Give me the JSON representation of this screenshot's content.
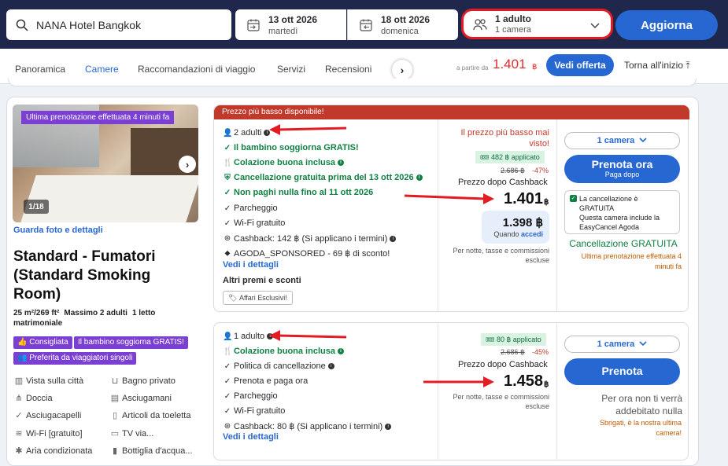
{
  "search": {
    "destination": "NANA Hotel Bangkok"
  },
  "checkin": {
    "date": "13 ott 2026",
    "day": "martedì"
  },
  "checkout": {
    "date": "18 ott 2026",
    "day": "domenica"
  },
  "guests": {
    "adults": "1 adulto",
    "rooms": "1 camera"
  },
  "update_label": "Aggiorna",
  "nav": {
    "tabs": [
      "Panoramica",
      "Camere",
      "Raccomandazioni di viaggio",
      "Servizi",
      "Recensioni"
    ],
    "active_tab": "Camere",
    "from_label": "a partire da",
    "from_price": "1.401",
    "from_currency": "฿",
    "offer_button": "Vedi offerta",
    "back_to_top": "Torna all'inizio"
  },
  "room": {
    "image_badge": "Ultima prenotazione effettuata 4 minuti fa",
    "image_count": "1/18",
    "photo_link": "Guarda foto e dettagli",
    "title": "Standard - Fumatori (Standard Smoking Room)",
    "size": "25 m²/269 ft²",
    "max_guests": "Massimo 2 adulti",
    "bed": "1 letto matrimoniale",
    "pills": [
      "Consigliata",
      "Il bambino soggiorna GRATIS!",
      "Preferita da viaggiatori singoli"
    ],
    "amenities": [
      "Vista sulla città",
      "Bagno privato",
      "Doccia",
      "Asciugamani",
      "Asciugacapelli",
      "Articoli da toeletta",
      "Wi-Fi [gratuito]",
      "TV via...",
      "Aria condizionata",
      "Bottiglia d'acqua..."
    ]
  },
  "offer1": {
    "header": "Prezzo più basso disponibile!",
    "occupancy": "2 adulti",
    "child_free": "Il bambino soggiorna GRATIS!",
    "breakfast": "Colazione buona inclusa",
    "free_cancel": "Cancellazione gratuita prima del 13 ott 2026",
    "pay_later": "Non paghi nulla fino al 11 ott 2026",
    "parking": "Parcheggio",
    "wifi": "Wi-Fi gratuito",
    "cashback": "Cashback: 142 ฿ (Si applicano i termini)",
    "sponsored": "AGODA_SPONSORED - 69 ฿ di sconto!",
    "details_link": "Vedi i dettagli",
    "other_title": "Altri premi e sconti",
    "exclusive_tag": "Affari Esclusivi!",
    "lowest_note": "Il prezzo più basso mai visto!",
    "applied": "482 ฿ applicato",
    "original_price": "2.686 ฿",
    "discount": "-47%",
    "after_cashback_label": "Prezzo dopo Cashback",
    "price": "1.401",
    "currency": "฿",
    "access_price": "1.398 ฿",
    "access_label": "Quando",
    "access_link": "accedi",
    "per_night": "Per notte, tasse e commissioni escluse",
    "room_select": "1 camera",
    "book_label": "Prenota ora",
    "book_sub": "Paga dopo",
    "cancel_title": "La cancellazione è GRATUITA",
    "cancel_body": "Questa camera include la EasyCancel Agoda",
    "free_cancel_green": "Cancellazione GRATUITA",
    "last_booked": "Ultima prenotazione effettuata 4 minuti fa"
  },
  "offer2": {
    "occupancy": "1 adulto",
    "breakfast": "Colazione buona inclusa",
    "cancel_policy": "Politica di cancellazione",
    "pay_later": "Prenota e paga ora",
    "parking": "Parcheggio",
    "wifi": "Wi-Fi gratuito",
    "cashback": "Cashback: 80 ฿ (Si applicano i termini)",
    "details_link": "Vedi i dettagli",
    "applied": "80 ฿ applicato",
    "original_price": "2.686 ฿",
    "discount": "-45%",
    "after_cashback_label": "Prezzo dopo Cashback",
    "price": "1.458",
    "currency": "฿",
    "per_night": "Per notte, tasse e commissioni escluse",
    "room_select": "1 camera",
    "book_label": "Prenota",
    "not_charged": "Per ora non ti verrà addebitato nulla",
    "hurry": "Sbrigati, è la nostra ultima camera!"
  },
  "colors": {
    "header_bg": "#20274d",
    "accent": "#2767d2",
    "highlight": "#e31b23",
    "green": "#108043",
    "purple": "#7b3fd4"
  }
}
